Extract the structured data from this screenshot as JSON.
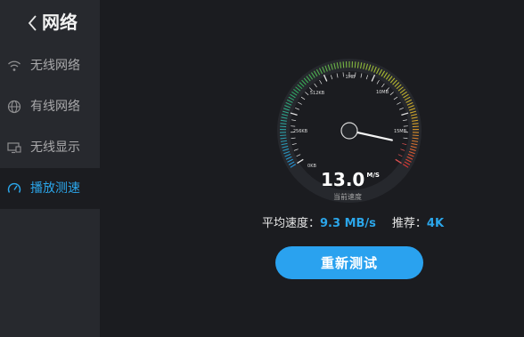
{
  "header": {
    "title": "网络"
  },
  "sidebar": {
    "items": [
      {
        "label": "无线网络",
        "icon": "wifi-icon",
        "active": false
      },
      {
        "label": "有线网络",
        "icon": "globe-icon",
        "active": false
      },
      {
        "label": "无线显示",
        "icon": "screen-cast-icon",
        "active": false
      },
      {
        "label": "播放测速",
        "icon": "speedometer-icon",
        "active": true
      }
    ]
  },
  "gauge": {
    "ticks": [
      "0KB",
      "256KB",
      "512KB",
      "1MB",
      "10MB",
      "15MB"
    ],
    "value_mb_s": 13.0,
    "speed_value": "13.0",
    "speed_unit": "M/S",
    "speed_caption": "当前速度"
  },
  "stats": {
    "avg_label": "平均速度：",
    "avg_value": "9.3 MB/s",
    "rec_label": "推荐：",
    "rec_value": "4K"
  },
  "actions": {
    "retest_label": "重新测试"
  },
  "colors": {
    "accent": "#2ba6ea",
    "button": "#2aa2ef",
    "sidebar_bg": "#27292e",
    "main_bg": "#1b1c20"
  }
}
